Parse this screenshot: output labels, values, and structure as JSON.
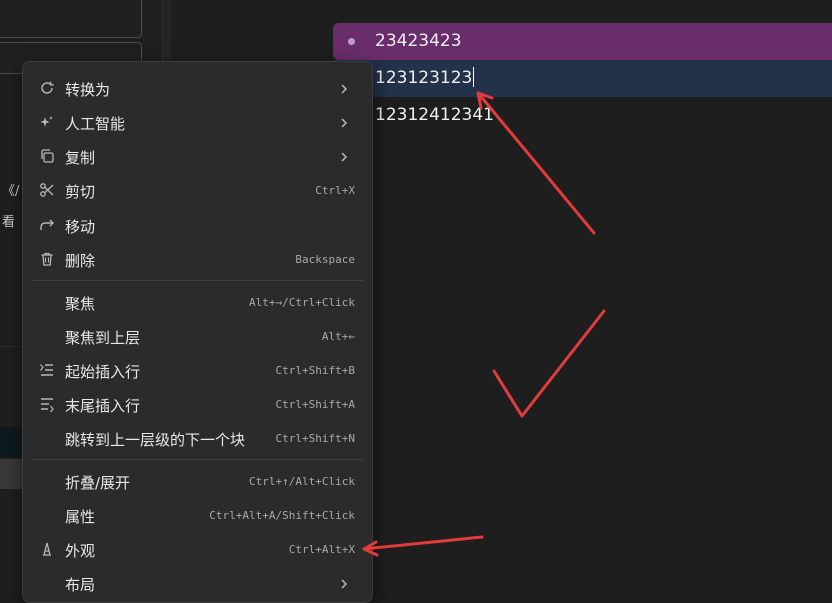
{
  "sidebar": {
    "fragment_1": "《/",
    "fragment_2": "看"
  },
  "editor": {
    "blocks": [
      {
        "text": "23423423"
      },
      {
        "text": "123123123"
      },
      {
        "text": "12312412341"
      }
    ]
  },
  "context_menu": {
    "items": [
      {
        "label": "转换为",
        "icon": "refresh-icon",
        "submenu": true
      },
      {
        "label": "人工智能",
        "icon": "sparkle-icon",
        "submenu": true
      },
      {
        "label": "复制",
        "icon": "copy-icon",
        "submenu": true
      },
      {
        "label": "剪切",
        "icon": "scissors-icon",
        "shortcut": "Ctrl+X"
      },
      {
        "label": "移动",
        "icon": "move-arrow-icon"
      },
      {
        "label": "删除",
        "icon": "trash-icon",
        "shortcut": "Backspace"
      },
      {
        "label": "聚焦",
        "shortcut": "Alt+→/Ctrl+Click"
      },
      {
        "label": "聚焦到上层",
        "shortcut": "Alt+←"
      },
      {
        "label": "起始插入行",
        "icon": "insert-before-icon",
        "shortcut": "Ctrl+Shift+B"
      },
      {
        "label": "末尾插入行",
        "icon": "insert-after-icon",
        "shortcut": "Ctrl+Shift+A"
      },
      {
        "label": "跳转到上一层级的下一个块",
        "shortcut": "Ctrl+Shift+N"
      },
      {
        "label": "折叠/展开",
        "shortcut": "Ctrl+↑/Alt+Click"
      },
      {
        "label": "属性",
        "shortcut": "Ctrl+Alt+A/Shift+Click"
      },
      {
        "label": "外观",
        "icon": "appearance-icon",
        "shortcut": "Ctrl+Alt+X"
      },
      {
        "label": "布局",
        "submenu": true
      }
    ]
  },
  "colors": {
    "annotation": "#e23b3b",
    "highlight_purple": "#6a2d6c",
    "highlight_blue": "#23314a"
  }
}
